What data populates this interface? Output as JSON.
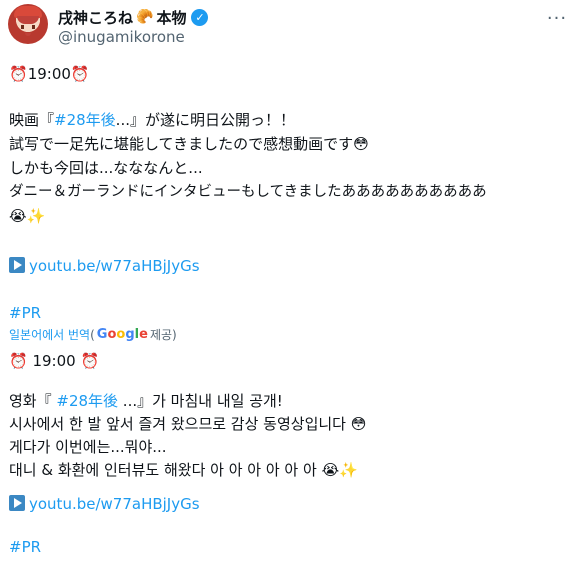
{
  "author": {
    "display_name": "戌神ころね",
    "name_emoji": "🥐",
    "name_suffix": "本物",
    "verified_mark": "✓",
    "handle": "@inugamikorone"
  },
  "menu": {
    "more_label": "···",
    "more_icon": "more-horizontal-icon"
  },
  "original": {
    "time_line": {
      "emoji": "⏰",
      "time": "19:00"
    },
    "line1_prefix": "映画『",
    "line1_tag": "#28年後",
    "line1_suffix": "...』が遂に明日公開っ！！",
    "line2": "試写で一足先に堪能してきましたので感想動画です",
    "line2_emoji": "😳",
    "line3": "しかも今回は...なななんと...",
    "line4": "ダニー＆ガーランドにインタビューもしてきましたああああああああああ",
    "line5_emojis": "😭✨",
    "link_text": "youtu.be/w77aHBjJyGs",
    "hashtag": "#PR"
  },
  "translation_bar": {
    "label": "일본어에서 번역",
    "open_paren": "(",
    "google_letters": [
      "G",
      "o",
      "o",
      "g",
      "l",
      "e"
    ],
    "provided": "제공)"
  },
  "translated": {
    "time_line": {
      "emoji": "⏰",
      "time": "19:00"
    },
    "line1_prefix": "영화『 ",
    "line1_tag": "#28年後",
    "line1_suffix": " ...』가 마침내 내일 공개!",
    "line2": "시사에서 한 발 앞서 즐겨 왔으므로 감상 동영상입니다 ",
    "line2_emoji": "😳",
    "line3": "게다가 이번에는...뭐야...",
    "line4": "대니 & 화환에 인터뷰도 해왔다 아 아 아 아 아 아 ",
    "line4_emojis": "😭✨",
    "link_text": "youtu.be/w77aHBjJyGs",
    "hashtag": "#PR"
  },
  "colors": {
    "link": "#1d9bf0",
    "text": "#0f1419",
    "muted": "#536471"
  }
}
